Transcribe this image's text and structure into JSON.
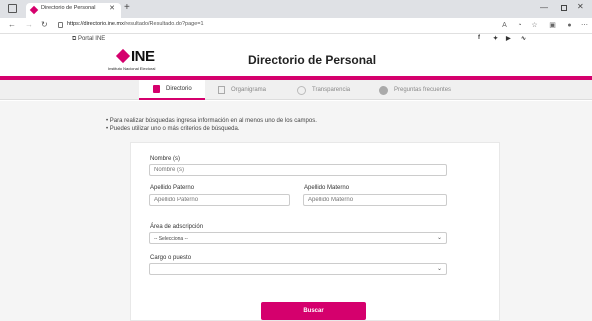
{
  "browser": {
    "tab_title": "Directorio de Personal",
    "url_host": "https://directorio.ine.mx",
    "url_path": "/resultado/Resultado.do?page=1"
  },
  "site": {
    "portal_link": "Portal INE",
    "logo_text": "INE",
    "logo_sub": "Instituto Nacional Electoral",
    "page_title": "Directorio de Personal",
    "brand_color": "#d5006d"
  },
  "nav": {
    "tabs": [
      {
        "label": "Directorio",
        "icon": "document-icon",
        "active": true
      },
      {
        "label": "Organigrama",
        "icon": "org-chart-icon",
        "active": false
      },
      {
        "label": "Transparencia",
        "icon": "circle-icon",
        "active": false
      },
      {
        "label": "Preguntas frecuentes",
        "icon": "question-icon",
        "active": false
      }
    ]
  },
  "instructions": [
    "• Para realizar búsquedas ingresa información en al menos uno de los campos.",
    "• Puedes utilizar uno o más criterios de búsqueda."
  ],
  "form": {
    "nombre_label": "Nombre (s)",
    "nombre_placeholder": "Nombre (s)",
    "paterno_label": "Apellido Paterno",
    "paterno_placeholder": "Apellido Paterno",
    "materno_label": "Apellido Materno",
    "materno_placeholder": "Apellido Materno",
    "area_label": "Área de adscripción",
    "area_value": "-- Selecciona --",
    "cargo_label": "Cargo o puesto",
    "cargo_value": "",
    "submit_label": "Buscar"
  }
}
